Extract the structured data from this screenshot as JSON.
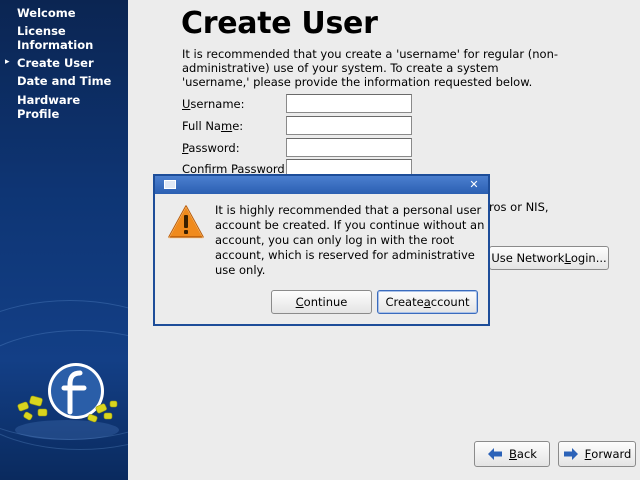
{
  "sidebar": {
    "items": [
      {
        "label": "Welcome"
      },
      {
        "label": "License Information"
      },
      {
        "label": "Create User"
      },
      {
        "label": "Date and Time"
      },
      {
        "label": "Hardware Profile"
      }
    ],
    "current_marker": "▸"
  },
  "page": {
    "title": "Create User",
    "intro": "It is recommended that you create a 'username' for regular (non-administrative) use of your system. To create a system 'username,' please provide the information requested below."
  },
  "form": {
    "username": {
      "label_pre": "",
      "label_u": "U",
      "label_post": "sername:",
      "value": ""
    },
    "fullname": {
      "label_pre": "Full Na",
      "label_u": "m",
      "label_post": "e:",
      "value": ""
    },
    "password": {
      "label_pre": "",
      "label_u": "P",
      "label_post": "assword:",
      "value": ""
    },
    "confirm": {
      "label_pre": "Confi",
      "label_u": "r",
      "label_post": "m Password:",
      "value": ""
    }
  },
  "auth_text": "ros or NIS,",
  "network_login": {
    "label_pre": "Use Network ",
    "label_u": "L",
    "label_post": "ogin..."
  },
  "nav": {
    "back": {
      "label_u": "B",
      "label_post": "ack"
    },
    "forward": {
      "label_u": "F",
      "label_post": "orward"
    }
  },
  "dialog": {
    "message": "It is highly recommended that a personal user account be created.  If you continue without an account, you can only log in with the root account, which is reserved for administrative use only.",
    "close_glyph": "✕",
    "continue": {
      "label_u": "C",
      "label_post": "ontinue"
    },
    "create": {
      "label_pre": "Create ",
      "label_u": "a",
      "label_post": "ccount"
    }
  },
  "colors": {
    "sidebar": "#0e3574",
    "dialog_title": "#2b5fb2",
    "warning": "#e8821e"
  }
}
